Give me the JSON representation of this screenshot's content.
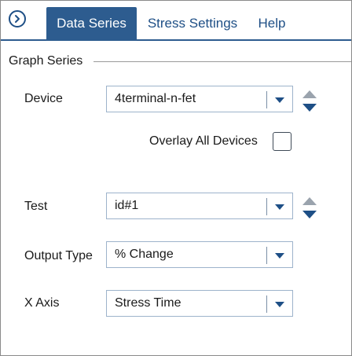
{
  "tabs": [
    {
      "label": "Data Series",
      "active": true
    },
    {
      "label": "Stress Settings",
      "active": false
    },
    {
      "label": "Help",
      "active": false
    }
  ],
  "nav_icon": "chevron-right-circle-icon",
  "group": {
    "title": "Graph Series"
  },
  "fields": {
    "device": {
      "label": "Device",
      "value": "4terminal-n-fet"
    },
    "overlay": {
      "label": "Overlay All Devices",
      "checked": false
    },
    "test": {
      "label": "Test",
      "value": "id#1"
    },
    "output_type": {
      "label": "Output Type",
      "value": "% Change"
    },
    "x_axis": {
      "label": "X Axis",
      "value": "Stress Time"
    }
  },
  "colors": {
    "accent": "#2d5c8f",
    "icon": "#1e4f86",
    "step_up": "#9aa3ad",
    "step_down": "#1e4f86"
  }
}
